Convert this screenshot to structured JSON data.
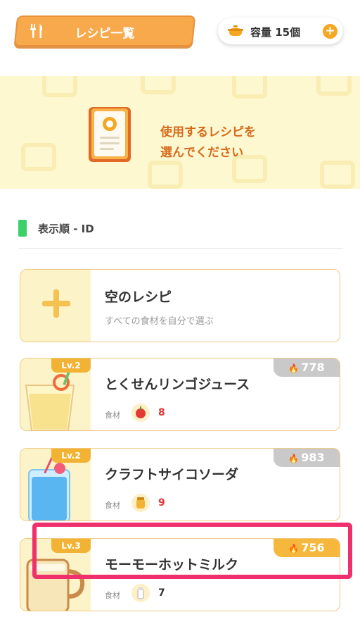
{
  "header": {
    "title": "レシピ一覧",
    "capacity_label": "容量",
    "capacity_value": "15個"
  },
  "banner": {
    "line1": "使用するレシピを",
    "line2": "選んでください"
  },
  "sort": {
    "label": "表示順 - ID"
  },
  "empty_recipe": {
    "title": "空のレシピ",
    "subtitle": "すべての食材を自分で選ぶ"
  },
  "recipes": [
    {
      "level": "Lv.2",
      "name": "とくせんリンゴジュース",
      "energy": "778",
      "ingredient_label": "食材",
      "ingredient_icon": "apple-icon",
      "ingredient_count": "8",
      "highlighted": false
    },
    {
      "level": "Lv.2",
      "name": "クラフトサイコソーダ",
      "energy": "983",
      "ingredient_label": "食材",
      "ingredient_icon": "honey-icon",
      "ingredient_count": "9",
      "highlighted": false
    },
    {
      "level": "Lv.3",
      "name": "モーモーホットミルク",
      "energy": "756",
      "ingredient_label": "食材",
      "ingredient_icon": "milk-bottle-icon",
      "ingredient_count": "7",
      "highlighted": true
    }
  ],
  "colors": {
    "accent_orange": "#f7a94b",
    "energy_gray": "#c9c9c9",
    "energy_active": "#f6b83c",
    "highlight": "#f0306c",
    "sort_green": "#3ccf6a"
  }
}
